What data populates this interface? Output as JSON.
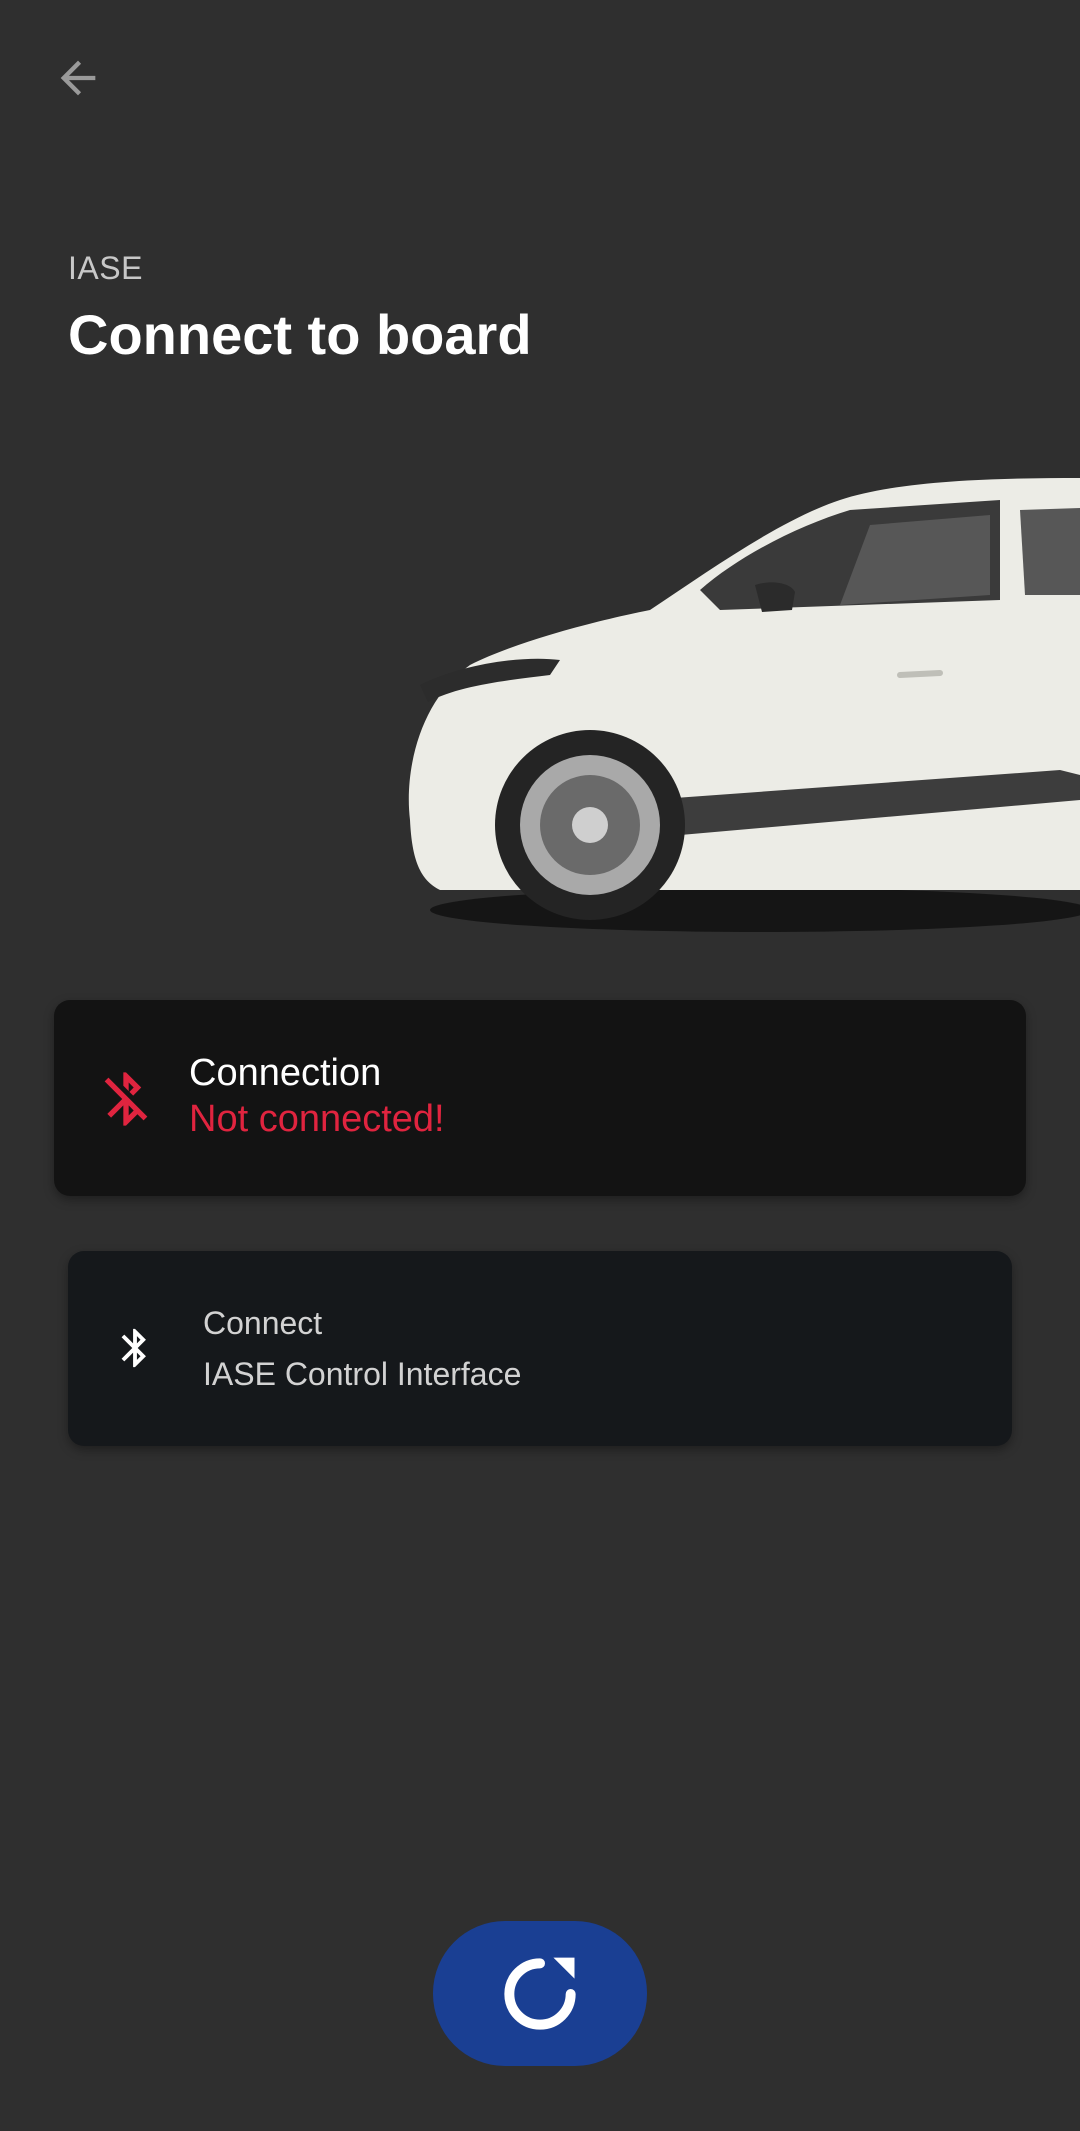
{
  "header": {
    "back_icon": "arrow-left-icon",
    "subtitle": "IASE",
    "title": "Connect to board"
  },
  "hero": {
    "image": "car-side-image"
  },
  "status_card": {
    "icon": "bluetooth-disabled-icon",
    "label": "Connection",
    "value": "Not connected!",
    "value_color": "#e0243f"
  },
  "device_card": {
    "icon": "bluetooth-icon",
    "action": "Connect",
    "device_name": "IASE Control Interface"
  },
  "refresh_button": {
    "icon": "refresh-icon",
    "color": "#1a3f93"
  }
}
